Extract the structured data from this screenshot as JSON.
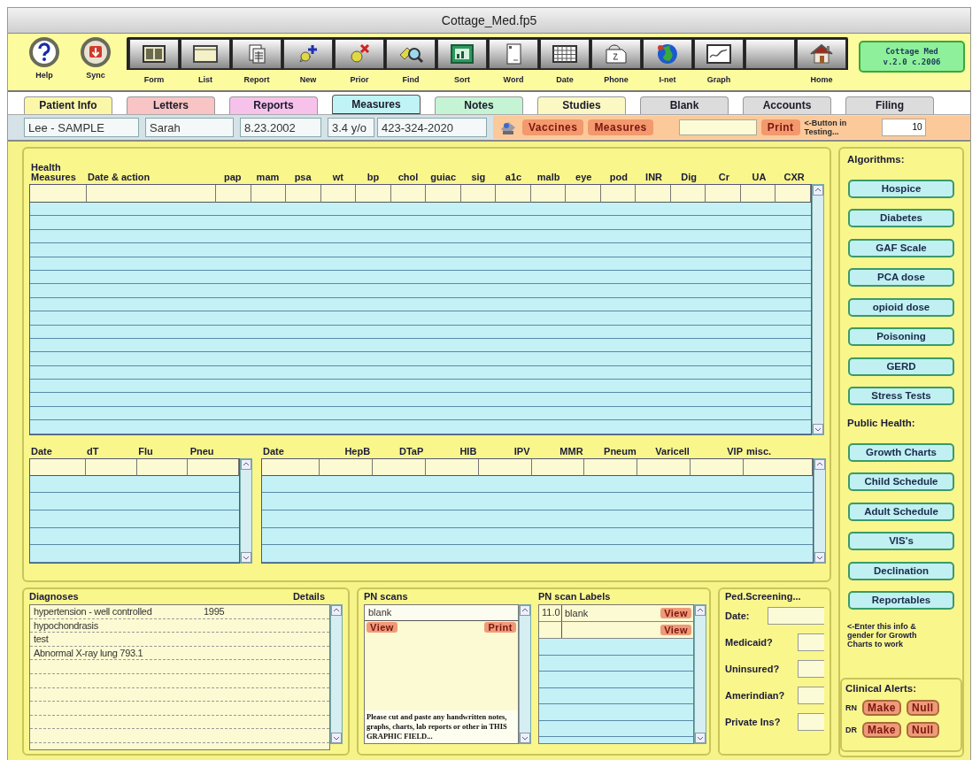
{
  "window": {
    "title": "Cottage_Med.fp5"
  },
  "toolbar": {
    "round_buttons": [
      {
        "kind": "help",
        "label": "Help"
      },
      {
        "kind": "sync",
        "label": "Sync"
      }
    ],
    "buttons": [
      {
        "kind": "form",
        "label": "Form"
      },
      {
        "kind": "list",
        "label": "List"
      },
      {
        "kind": "report",
        "label": "Report"
      },
      {
        "kind": "new",
        "label": "New"
      },
      {
        "kind": "prior",
        "label": "Prior"
      },
      {
        "kind": "find",
        "label": "Find"
      },
      {
        "kind": "sort",
        "label": "Sort"
      },
      {
        "kind": "word",
        "label": "Word"
      },
      {
        "kind": "date",
        "label": "Date"
      },
      {
        "kind": "phone",
        "label": "Phone"
      },
      {
        "kind": "inet",
        "label": "I-net"
      },
      {
        "kind": "graph",
        "label": "Graph"
      },
      {
        "kind": "blank"
      },
      {
        "kind": "home",
        "label": "Home"
      }
    ],
    "badge": [
      "Cottage Med",
      "v.2.0 c.2006"
    ]
  },
  "tabs": [
    {
      "label": "Patient Info",
      "selected": false,
      "color": "#fbf7a8"
    },
    {
      "label": "Letters",
      "selected": false,
      "color": "#f8c4c4"
    },
    {
      "label": "Reports",
      "selected": false,
      "color": "#f6c2ec"
    },
    {
      "label": "Measures",
      "selected": true,
      "color": "#bff3f6"
    },
    {
      "label": "Notes",
      "selected": false,
      "color": "#c4f4d4"
    },
    {
      "label": "Studies",
      "selected": false,
      "color": "#fcf8c4"
    },
    {
      "label": "Blank",
      "selected": false,
      "color": "#dcdcdc"
    },
    {
      "label": "Accounts",
      "selected": false,
      "color": "#dcdcdc"
    },
    {
      "label": "Filing",
      "selected": false,
      "color": "#dcdcdc"
    }
  ],
  "patient": {
    "fields": [
      "Lee - SAMPLE",
      "Sarah",
      "8.23.2002",
      "3.4 y/o",
      "423-324-2020"
    ],
    "buttons": [
      "Vaccines",
      "Measures"
    ],
    "print": "Print",
    "note": "<-Button in Testing...",
    "counter": "10"
  },
  "health_measures": {
    "columns": [
      "Health Measures",
      "Date & action",
      "pap",
      "mam",
      "psa",
      "wt",
      "bp",
      "chol",
      "guiac",
      "sig",
      "a1c",
      "malb",
      "eye",
      "pod",
      "INR",
      "Dig",
      "Cr",
      "UA",
      "CXR"
    ]
  },
  "vaccines_left": {
    "columns": [
      "Date",
      "dT",
      "Flu",
      "Pneu"
    ]
  },
  "vaccines_right": {
    "columns": [
      "Date",
      "HepB",
      "DTaP",
      "HIB",
      "IPV",
      "MMR",
      "Pneum",
      "Varicell",
      "VIP",
      "misc."
    ]
  },
  "diagnoses": {
    "title": "Diagnoses",
    "details": "Details",
    "rows": [
      {
        "text": "hypertension - well controlled",
        "year": "1995"
      },
      {
        "text": "hypochondrasis"
      },
      {
        "text": "test"
      },
      {
        "text": "Abnormal X-ray lung 793.1"
      }
    ]
  },
  "pn_scans": {
    "title": "PN scans",
    "field": "blank",
    "view": "View",
    "print": "Print",
    "note": "Please cut and paste any handwritten notes, graphs, charts, lab reports or other in THIS GRAPHIC FIELD..."
  },
  "pn_scan_labels": {
    "title": "PN scan Labels",
    "rows": [
      {
        "number": "11.0",
        "label": "blank",
        "button": "View"
      },
      {
        "button": "View"
      }
    ]
  },
  "ped_screening": {
    "title": "Ped.Screening...",
    "fields": [
      "Date:",
      "Medicaid?",
      "Uninsured?",
      "Amerindian?",
      "Private Ins?"
    ]
  },
  "sidebar": {
    "sections": [
      {
        "heading": "Algorithms:",
        "buttons": [
          "Hospice",
          "Diabetes",
          "GAF Scale",
          "PCA dose",
          "opioid dose",
          "Poisoning",
          "GERD",
          "Stress Tests"
        ]
      },
      {
        "heading": "Public Health:",
        "buttons": [
          "Growth Charts",
          "Child Schedule",
          "Adult Schedule",
          "VIS's",
          "Declination",
          "Reportables"
        ]
      }
    ],
    "note": "<-Enter this info & gender for Growth Charts to work",
    "clinical_alerts": {
      "title": "Clinical Alerts:",
      "rows": [
        {
          "role": "RN",
          "buttons": [
            "Make",
            "Null"
          ]
        },
        {
          "role": "DR",
          "buttons": [
            "Make",
            "Null"
          ]
        }
      ]
    }
  }
}
